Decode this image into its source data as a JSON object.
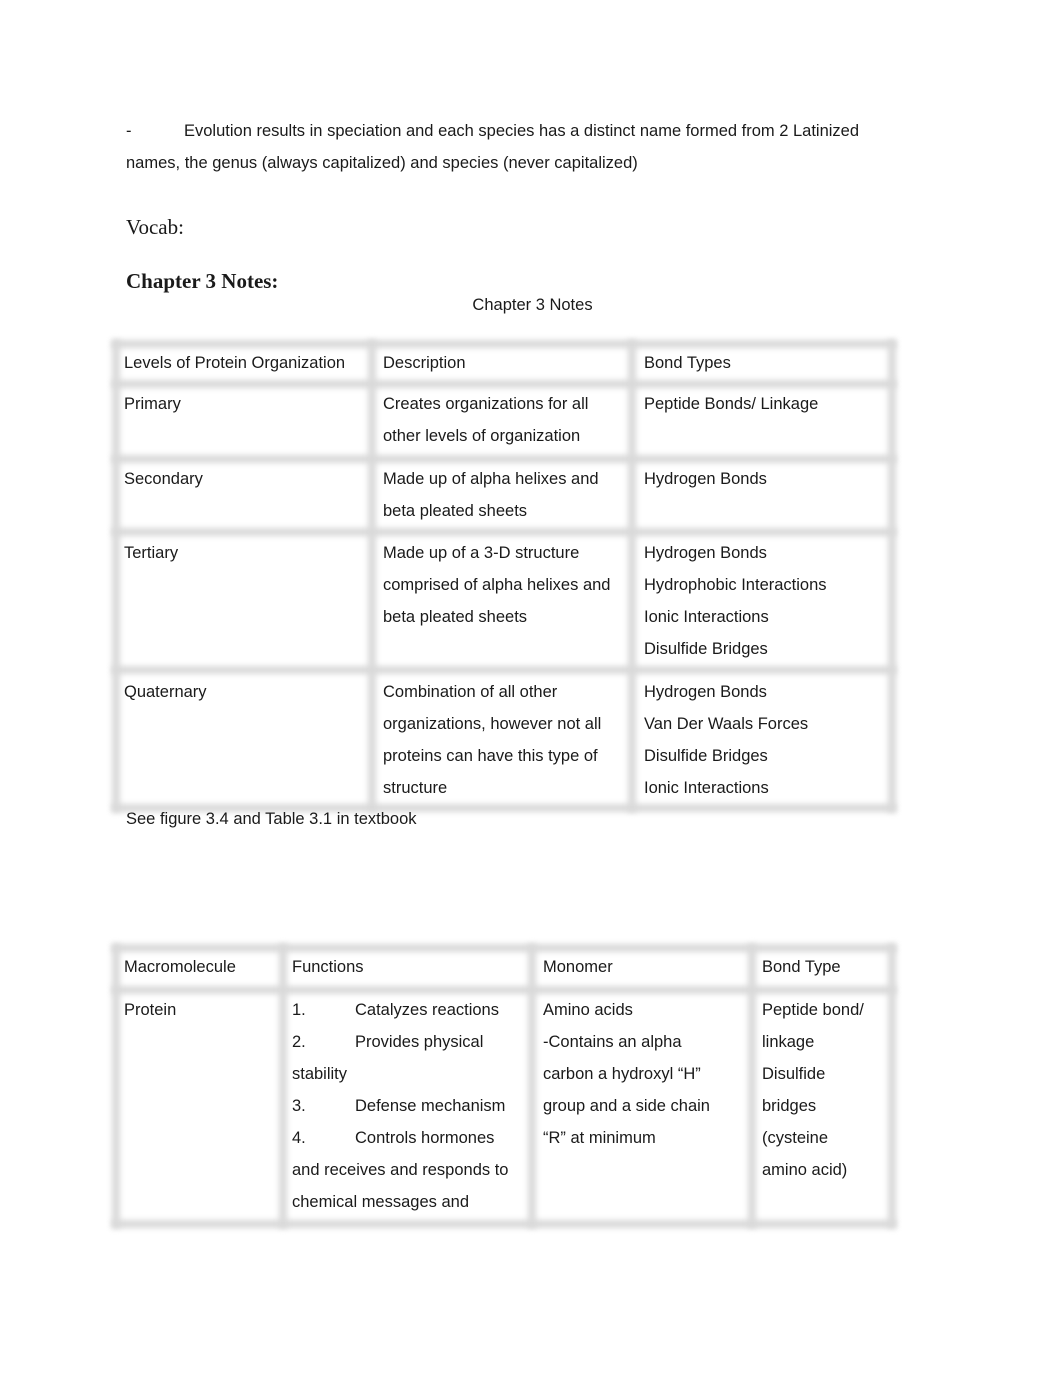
{
  "document": {
    "bullet": {
      "marker": "-",
      "line1": "Evolution results in speciation and each species has a distinct name formed from 2 Latinized",
      "line2": "names, the genus (always capitalized) and species (never capitalized)"
    },
    "vocab_label": "Vocab:",
    "chapter_heading": "Chapter 3 Notes:",
    "chapter_title": "Chapter 3 Notes",
    "protein_table": {
      "headers": [
        "Levels of Protein Organization",
        "Description",
        "Bond Types"
      ],
      "rows": [
        {
          "level": "Primary",
          "description": [
            "Creates organizations for all",
            "other levels of organization"
          ],
          "bonds": [
            "Peptide Bonds/ Linkage"
          ]
        },
        {
          "level": "Secondary",
          "description": [
            "Made up of alpha helixes and",
            "beta pleated sheets"
          ],
          "bonds": [
            "Hydrogen Bonds"
          ]
        },
        {
          "level": "Tertiary",
          "description": [
            "Made up of a 3-D structure",
            "comprised of alpha helixes and",
            "beta pleated sheets"
          ],
          "bonds": [
            "Hydrogen Bonds",
            "Hydrophobic Interactions",
            "Ionic Interactions",
            "Disulfide Bridges"
          ]
        },
        {
          "level": "Quaternary",
          "description": [
            "Combination of all other",
            "organizations, however not all",
            "proteins can have this type of",
            "structure"
          ],
          "bonds": [
            "Hydrogen Bonds",
            "Van Der Waals Forces",
            "Disulfide Bridges",
            "Ionic Interactions"
          ]
        }
      ]
    },
    "table_note": "See figure 3.4 and Table 3.1 in textbook",
    "macro_table": {
      "headers": [
        "Macromolecule",
        "Functions",
        "Monomer",
        "Bond Type"
      ],
      "rows": [
        {
          "macromolecule": "Protein",
          "functions": [
            {
              "num": "1.",
              "text": "Catalyzes reactions"
            },
            {
              "num": "2.",
              "text": "Provides physical"
            },
            {
              "num": "",
              "text": "stability"
            },
            {
              "num": "3.",
              "text": "Defense mechanism"
            },
            {
              "num": "4.",
              "text": "Controls hormones"
            },
            {
              "num": "",
              "text": "and receives and responds to"
            },
            {
              "num": "",
              "text": "chemical messages and"
            }
          ],
          "monomer": [
            "Amino acids",
            "-Contains an alpha",
            "carbon a hydroxyl “H”",
            "group and a side chain",
            "“R” at minimum"
          ],
          "bond_type": [
            "Peptide bond/",
            "linkage",
            "Disulfide",
            "bridges",
            "(cysteine",
            "amino acid)"
          ]
        }
      ]
    }
  }
}
